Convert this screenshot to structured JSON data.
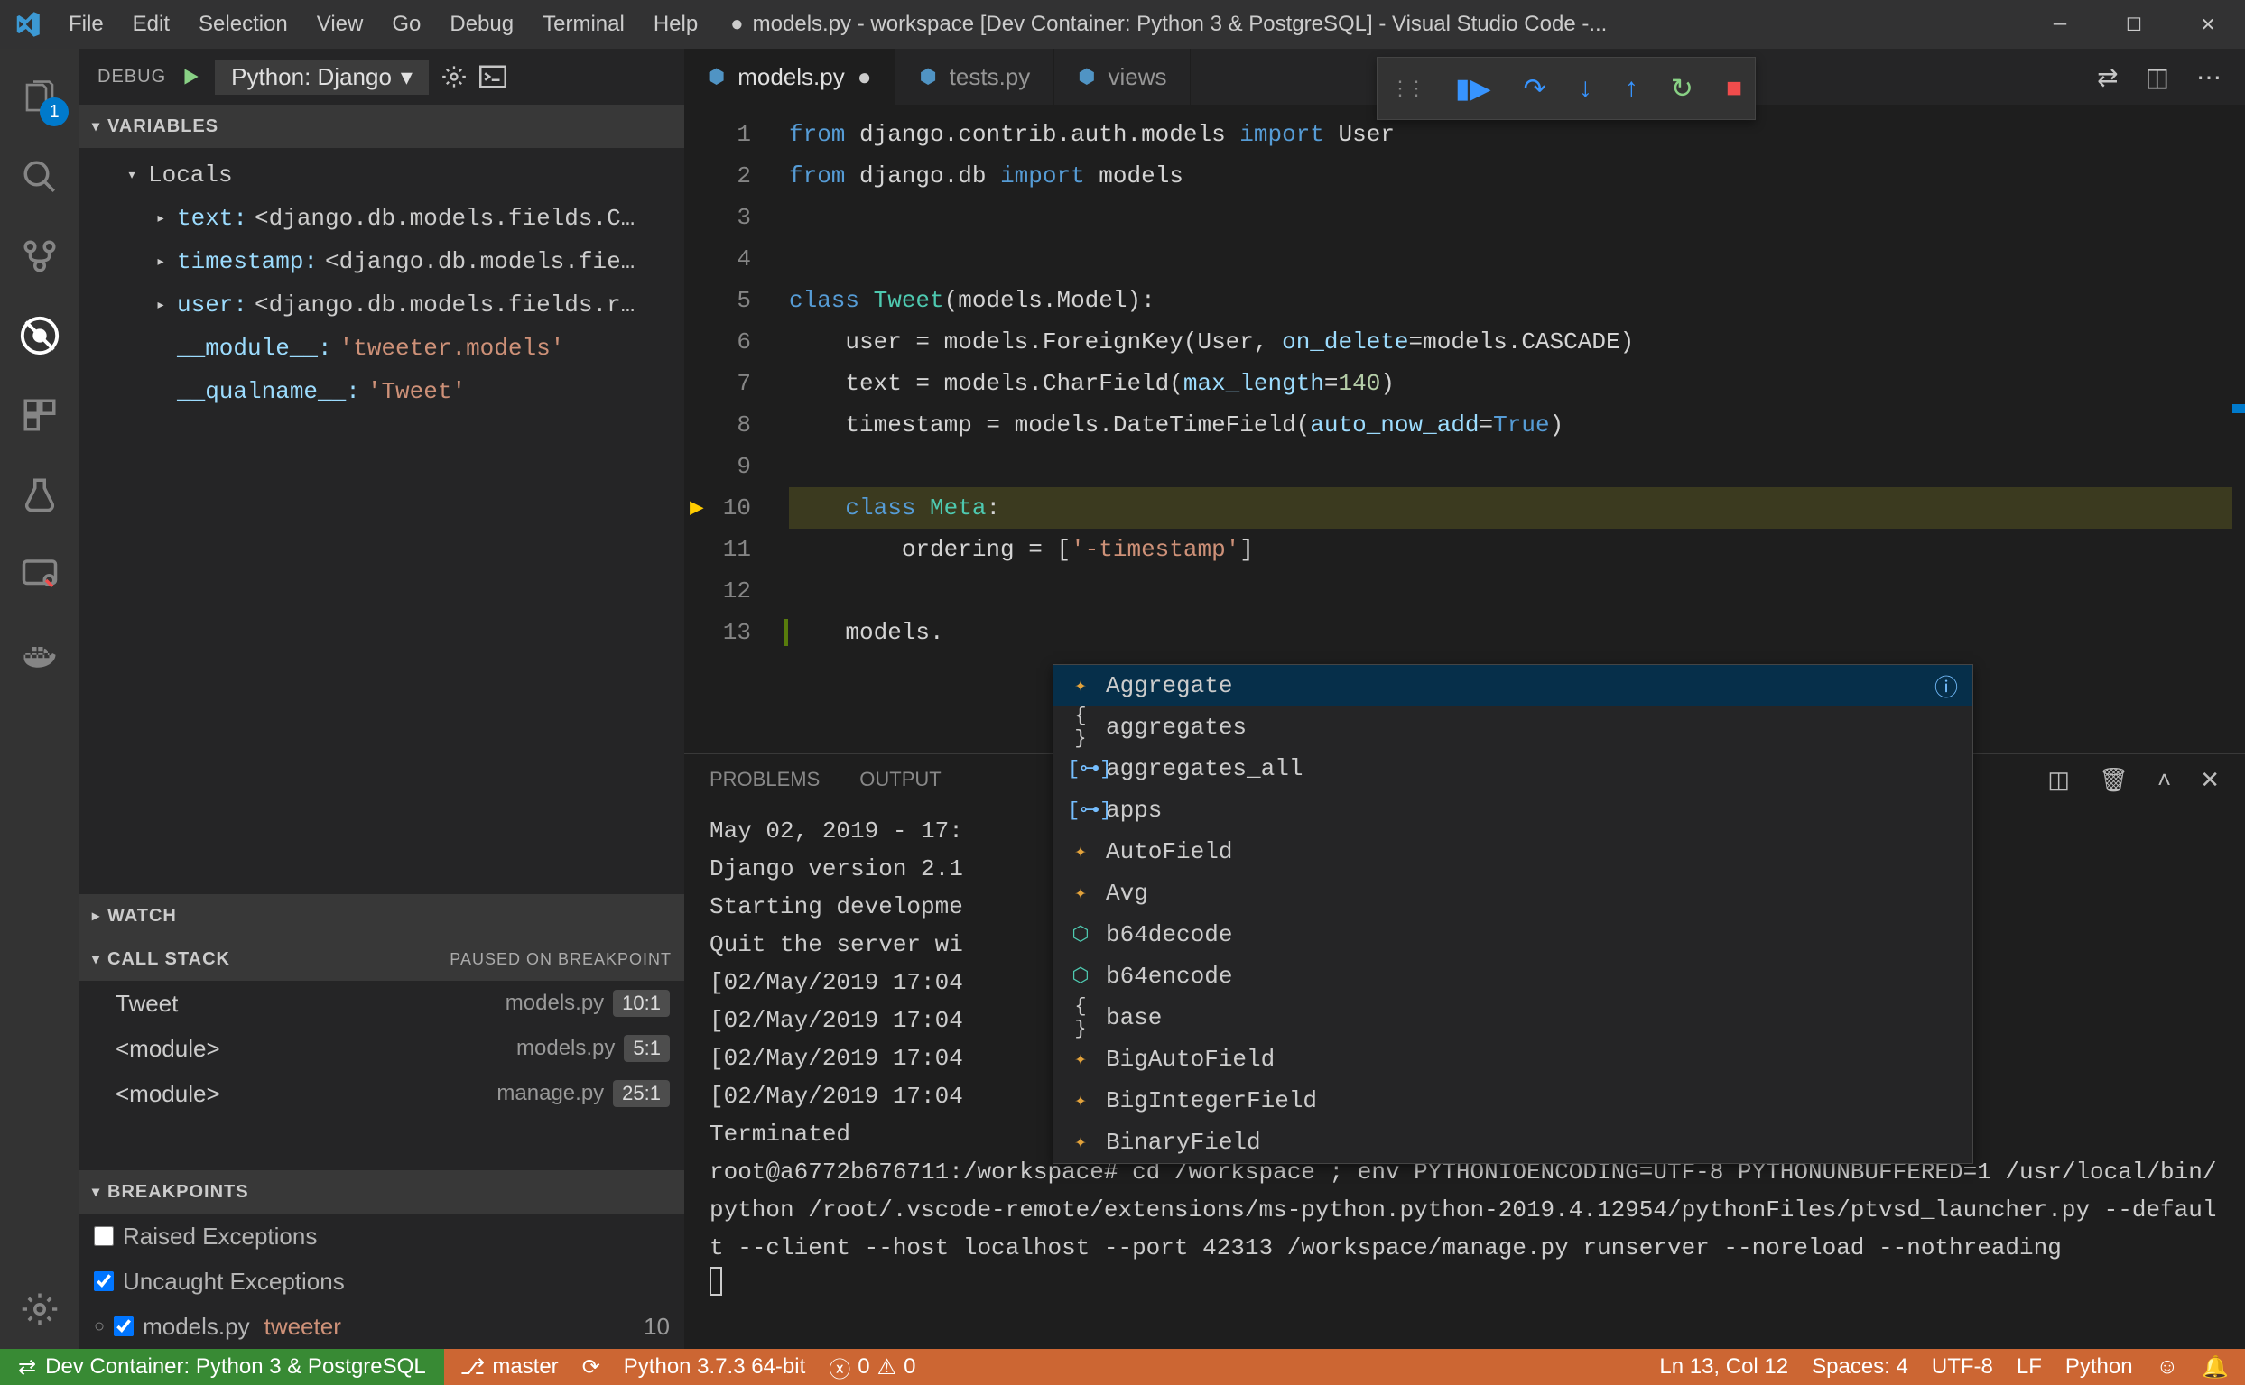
{
  "menubar": [
    "File",
    "Edit",
    "Selection",
    "View",
    "Go",
    "Debug",
    "Terminal",
    "Help"
  ],
  "window_title": "models.py - workspace [Dev Container: Python 3 & PostgreSQL] - Visual Studio Code -...",
  "activity_badge": "1",
  "debug_header": {
    "label": "DEBUG",
    "config": "Python: Django"
  },
  "sections": {
    "variables": "VARIABLES",
    "watch": "WATCH",
    "callstack": "CALL STACK",
    "callstack_state": "PAUSED ON BREAKPOINT",
    "breakpoints": "BREAKPOINTS"
  },
  "locals_label": "Locals",
  "locals": [
    {
      "key": "text:",
      "val": "<django.db.models.fields.C…"
    },
    {
      "key": "timestamp:",
      "val": "<django.db.models.fie…"
    },
    {
      "key": "user:",
      "val": "<django.db.models.fields.r…"
    }
  ],
  "locals_extra": [
    {
      "key": "__module__:",
      "val": "'tweeter.models'"
    },
    {
      "key": "__qualname__:",
      "val": "'Tweet'"
    }
  ],
  "callstack": [
    {
      "name": "Tweet",
      "file": "models.py",
      "pos": "10:1"
    },
    {
      "name": "<module>",
      "file": "models.py",
      "pos": "5:1"
    },
    {
      "name": "<module>",
      "file": "manage.py",
      "pos": "25:1"
    }
  ],
  "breakpoints": {
    "raised": "Raised Exceptions",
    "uncaught": "Uncaught Exceptions",
    "file": "models.py",
    "file_scope": "tweeter",
    "file_count": "10"
  },
  "tabs": [
    {
      "name": "models.py",
      "active": true,
      "dirty": true
    },
    {
      "name": "tests.py",
      "active": false,
      "dirty": false
    },
    {
      "name": "views",
      "active": false,
      "dirty": false
    }
  ],
  "code": {
    "lines": [
      {
        "n": "1",
        "html": "<span class='kw'>from</span> django.contrib.auth.models <span class='kw'>import</span> User"
      },
      {
        "n": "2",
        "html": "<span class='kw'>from</span> django.db <span class='kw'>import</span> models"
      },
      {
        "n": "3",
        "html": ""
      },
      {
        "n": "4",
        "html": ""
      },
      {
        "n": "5",
        "html": "<span class='kw'>class</span> <span class='cls'>Tweet</span>(models.Model):"
      },
      {
        "n": "6",
        "html": "    user = models.ForeignKey(User, <span class='prm'>on_delete</span>=models.CASCADE)"
      },
      {
        "n": "7",
        "html": "    text = models.CharField(<span class='prm'>max_length</span>=<span class='num'>140</span>)"
      },
      {
        "n": "8",
        "html": "    timestamp = models.DateTimeField(<span class='prm'>auto_now_add</span>=<span class='bool'>True</span>)"
      },
      {
        "n": "9",
        "html": ""
      },
      {
        "n": "10",
        "html": "    <span class='kw'>class</span> <span class='cls'>Meta</span>:",
        "hl": true,
        "bp": true
      },
      {
        "n": "11",
        "html": "        ordering = [<span class='str'>'-timestamp'</span>]"
      },
      {
        "n": "12",
        "html": ""
      },
      {
        "n": "13",
        "html": "    models.",
        "insert": true
      }
    ]
  },
  "suggest": [
    {
      "icon": "class",
      "label": "Aggregate",
      "sel": true,
      "info": true
    },
    {
      "icon": "ns",
      "label": "aggregates"
    },
    {
      "icon": "val",
      "label": "aggregates_all"
    },
    {
      "icon": "val",
      "label": "apps"
    },
    {
      "icon": "class",
      "label": "AutoField"
    },
    {
      "icon": "class",
      "label": "Avg"
    },
    {
      "icon": "mod",
      "label": "b64decode"
    },
    {
      "icon": "mod",
      "label": "b64encode"
    },
    {
      "icon": "ns",
      "label": "base"
    },
    {
      "icon": "class",
      "label": "BigAutoField"
    },
    {
      "icon": "class",
      "label": "BigIntegerField"
    },
    {
      "icon": "class",
      "label": "BinaryField"
    }
  ],
  "panel": {
    "tabs": [
      "PROBLEMS",
      "OUTPUT"
    ],
    "lines": [
      "May 02, 2019 - 17:",
      "Django version 2.1",
      "Starting developme",
      "Quit the server wi",
      "[02/May/2019 17:04",
      "[02/May/2019 17:04",
      "[02/May/2019 17:04",
      "[02/May/2019 17:04",
      "Terminated",
      "root@a6772b676711:/workspace# cd /workspace ; env PYTHONIOENCODING=UTF-8 PYTHONUNBUFFERED=1 /usr/local/bin/python /root/.vscode-remote/extensions/ms-python.python-2019.4.12954/pythonFiles/ptvsd_launcher.py --default --client --host localhost --port 42313 /workspace/manage.py runserver --noreload --nothreading"
    ]
  },
  "status": {
    "remote": "Dev Container: Python 3 & PostgreSQL",
    "branch": "master",
    "python": "Python 3.7.3 64-bit",
    "errors": "0",
    "warnings": "0",
    "lncol": "Ln 13, Col 12",
    "spaces": "Spaces: 4",
    "encoding": "UTF-8",
    "eol": "LF",
    "lang": "Python"
  }
}
